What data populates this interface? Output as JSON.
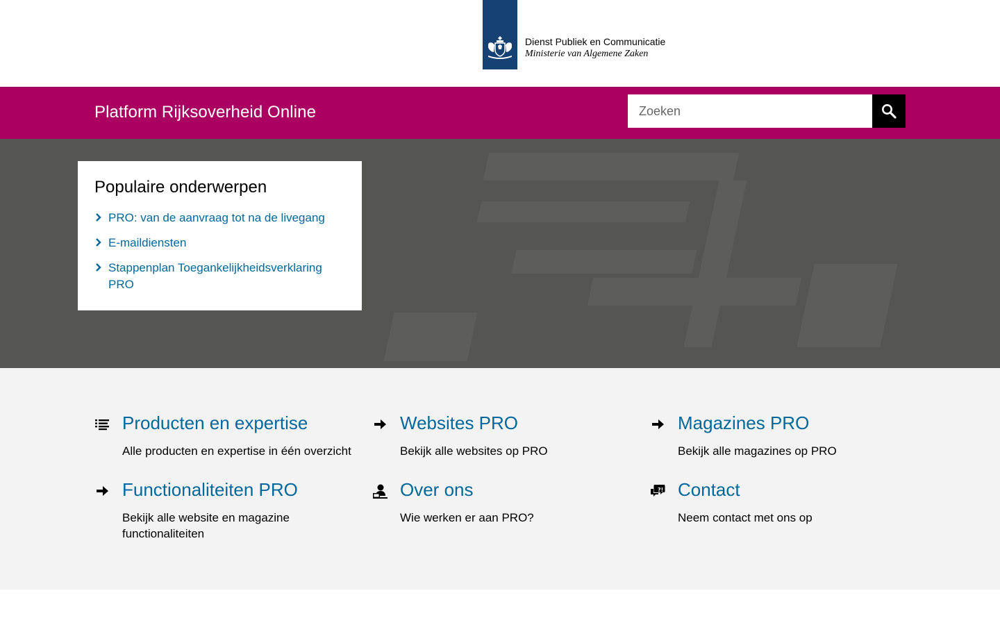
{
  "logo": {
    "line1": "Dienst Publiek en Communicatie",
    "line2": "Ministerie van Algemene Zaken",
    "brand_color": "#154273",
    "icon": "coat-of-arms-icon"
  },
  "header": {
    "site_title": "Platform Rijksoverheid Online",
    "bar_color": "#a90061"
  },
  "search": {
    "placeholder": "Zoeken",
    "button_icon": "search-icon"
  },
  "popular": {
    "heading": "Populaire onderwerpen",
    "items": [
      {
        "label": "PRO: van de aanvraag tot na de livegang"
      },
      {
        "label": "E-maildiensten"
      },
      {
        "label": "Stappenplan Toegankelijkheidsverklaring PRO"
      }
    ]
  },
  "tiles": [
    {
      "title": "Producten en expertise",
      "desc": "Alle producten en expertise in één overzicht",
      "icon": "list-icon"
    },
    {
      "title": "Websites PRO",
      "desc": "Bekijk alle websites op PRO",
      "icon": "arrow-right-icon"
    },
    {
      "title": "Magazines PRO",
      "desc": "Bekijk alle magazines op PRO",
      "icon": "arrow-right-icon"
    },
    {
      "title": "Functionaliteiten PRO",
      "desc": "Bekijk alle website en magazine functionaliteiten",
      "icon": "arrow-right-icon"
    },
    {
      "title": "Over ons",
      "desc": "Wie werken er aan PRO?",
      "icon": "person-at-desk-icon"
    },
    {
      "title": "Contact",
      "desc": "Neem contact met ons op",
      "icon": "speech-bubbles-icon"
    }
  ],
  "colors": {
    "link": "#01689b",
    "hero_bg": "#555554",
    "tiles_bg": "#f3f3f3"
  }
}
